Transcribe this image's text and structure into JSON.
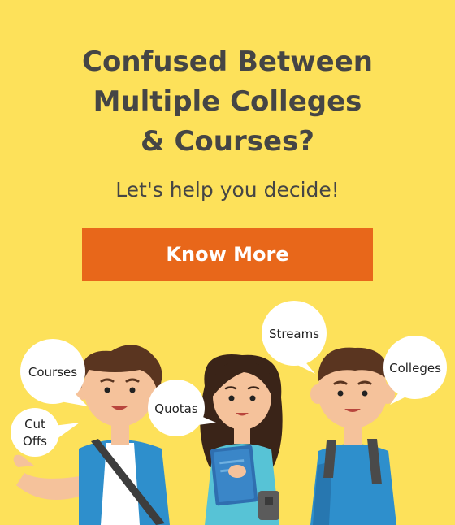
{
  "banner": {
    "headline_lines": [
      "Confused Between",
      "Multiple Colleges",
      "& Courses?"
    ],
    "subtitle": "Let's help you decide!",
    "cta_label": "Know More"
  },
  "bubbles": {
    "courses": "Courses",
    "cut_offs_line1": "Cut",
    "cut_offs_line2": "Offs",
    "quotas": "Quotas",
    "streams": "Streams",
    "colleges": "Colleges"
  },
  "colors": {
    "background": "#fde15a",
    "heading_text": "#454545",
    "button": "#e8671a",
    "button_text": "#ffffff"
  }
}
